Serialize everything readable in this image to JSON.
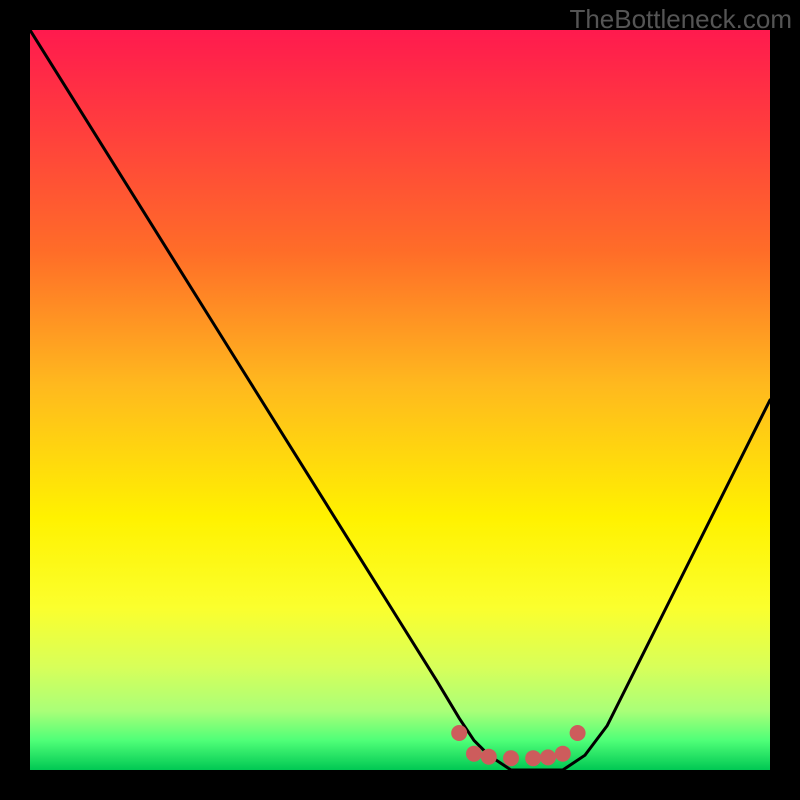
{
  "watermark": "TheBottleneck.com",
  "chart_data": {
    "type": "line",
    "title": "",
    "xlabel": "",
    "ylabel": "",
    "xlim": [
      0,
      100
    ],
    "ylim": [
      0,
      100
    ],
    "series": [
      {
        "name": "bottleneck-curve",
        "x": [
          0,
          5,
          10,
          15,
          20,
          25,
          30,
          35,
          40,
          45,
          50,
          55,
          58,
          60,
          62,
          65,
          68,
          70,
          72,
          75,
          78,
          80,
          85,
          90,
          95,
          100
        ],
        "y": [
          100,
          92,
          84,
          76,
          68,
          60,
          52,
          44,
          36,
          28,
          20,
          12,
          7,
          4,
          2,
          0,
          0,
          0,
          0,
          2,
          6,
          10,
          20,
          30,
          40,
          50
        ]
      },
      {
        "name": "optimal-band-markers",
        "x": [
          58,
          60,
          62,
          65,
          68,
          70,
          72,
          74
        ],
        "y": [
          5,
          2.2,
          1.8,
          1.6,
          1.6,
          1.7,
          2.2,
          5
        ]
      }
    ],
    "colors": {
      "gradient_top": "#ff1a4e",
      "gradient_mid": "#fff200",
      "gradient_bottom": "#00c853",
      "curve": "#000000",
      "markers": "#cd5c5c"
    }
  }
}
